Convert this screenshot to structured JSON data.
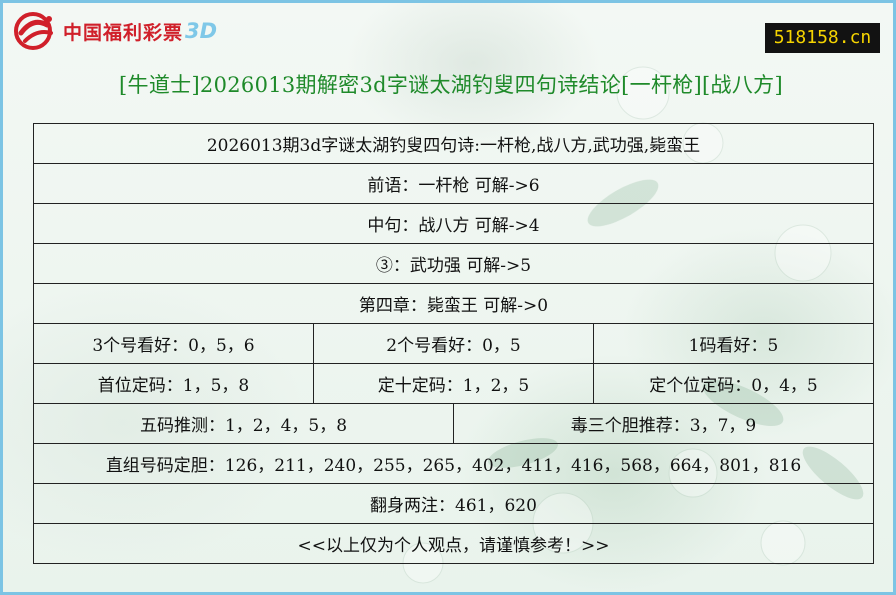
{
  "logo": {
    "text": "中国福利彩票",
    "suffix": "3D",
    "color": "#d0202a",
    "accent": "#7fc8e8"
  },
  "site_badge": "518158.cn",
  "page_title": "[牛道士]2026013期解密3d字谜太湖钓叟四句诗结论[一杆枪][战八方]",
  "table": {
    "poem": "2026013期3d字谜太湖钓叟四句诗:一杆枪,战八方,武功强,毙蛮王",
    "line1": "前语：一杆枪 可解->6",
    "line2": "中句：战八方 可解->4",
    "line3": "③：武功强 可解->5",
    "line4": "第四章：毙蛮王 可解->0",
    "pick3": "3个号看好：0，5，6",
    "pick2": "2个号看好：0，5",
    "pick1": "1码看好：5",
    "hundreds": "首位定码：1，5，8",
    "tens": "定十定码：1，2，5",
    "units": "定个位定码：0，4，5",
    "five_codes": "五码推测：1，2，4，5，8",
    "three_bold": "毒三个胆推荐：3，7，9",
    "direct_groups": "直组号码定胆：126，211，240，255，265，402，411，416，568，664，801，816",
    "two_bets": "翻身两注：461，620",
    "disclaimer": "<<以上仅为个人观点，请谨慎参考！>>"
  }
}
